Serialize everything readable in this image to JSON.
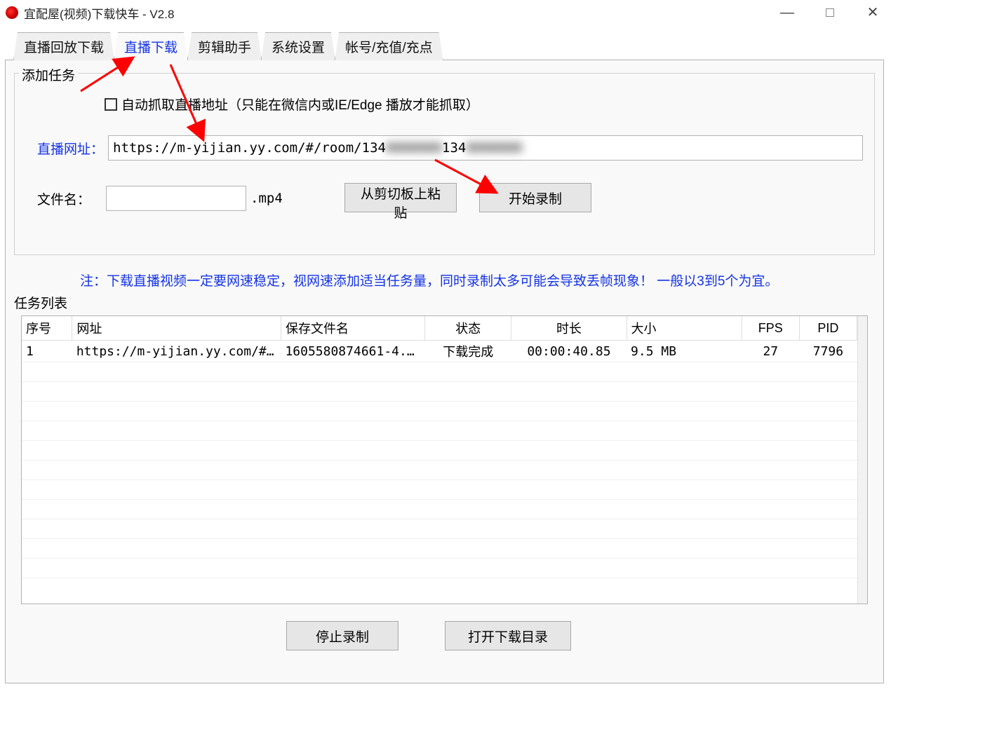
{
  "window": {
    "title": "宜配屋(视频)下载快车 - V2.8"
  },
  "tabs": [
    "直播回放下载",
    "直播下载",
    "剪辑助手",
    "系统设置",
    "帐号/充值/充点"
  ],
  "active_tab_index": 1,
  "form": {
    "group_title": "添加任务",
    "auto_capture_label": "自动抓取直播地址（只能在微信内或IE/Edge 播放才能抓取）",
    "auto_capture_checked": false,
    "url_label": "直播网址：",
    "url_value_visible_prefix": "https://m-yijian.yy.com/#/room/134",
    "url_value_visible_mid": "134",
    "filename_label": "文件名：",
    "filename_value": "",
    "ext": ".mp4",
    "buttons": {
      "paste": "从剪切板上粘贴",
      "start": "开始录制"
    }
  },
  "note": "注：下载直播视频一定要网速稳定，视网速添加适当任务量，同时录制太多可能会导致丢帧现象！  一般以3到5个为宜。",
  "list_title": "任务列表",
  "columns": {
    "idx": "序号",
    "url": "网址",
    "file": "保存文件名",
    "status": "状态",
    "dur": "时长",
    "size": "大小",
    "fps": "FPS",
    "pid": "PID"
  },
  "rows": [
    {
      "idx": "1",
      "url": "https://m-yijian.yy.com/#/...",
      "file": "1605580874661-4...",
      "status": "下载完成",
      "dur": "00:00:40.85",
      "size": "9.5 MB",
      "fps": "27",
      "pid": "7796"
    }
  ],
  "bottom_buttons": {
    "stop": "停止录制",
    "open_dir": "打开下载目录"
  }
}
